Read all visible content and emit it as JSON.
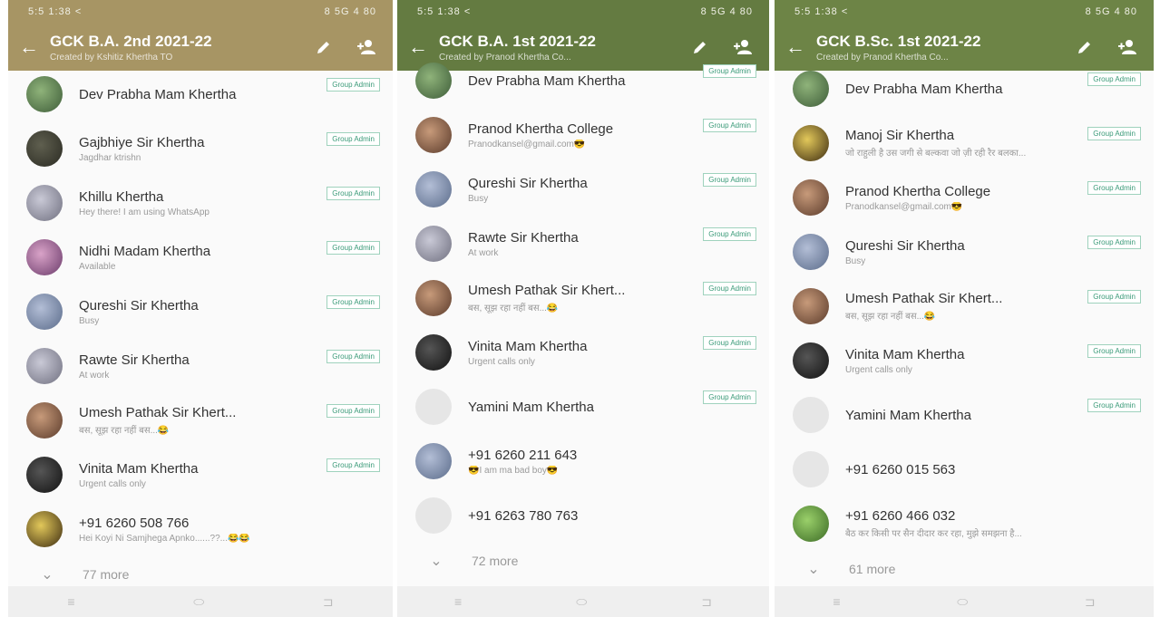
{
  "colors": {
    "panel1_header": "#a79564",
    "panel2_header": "#647b41",
    "panel3_header": "#6d8446",
    "badge_text": "#3a9a78"
  },
  "panels": [
    {
      "status_time": "5:5 1:38 <",
      "status_icons": "8 5G 4 80",
      "title": "GCK B.A. 2nd 2021-22",
      "subtitle": "Created by Kshitiz Khertha TO",
      "members": [
        {
          "name": "Dev Prabha Mam Khertha",
          "status": "",
          "admin": true
        },
        {
          "name": "Gajbhiye Sir Khertha",
          "status": "Jagdhar ktrishn",
          "admin": true
        },
        {
          "name": "Khillu Khertha",
          "status": "Hey there! I am using WhatsApp",
          "admin": true
        },
        {
          "name": "Nidhi Madam Khertha",
          "status": "Available",
          "admin": true
        },
        {
          "name": "Qureshi Sir Khertha",
          "status": "Busy",
          "admin": true
        },
        {
          "name": "Rawte Sir Khertha",
          "status": "At work",
          "admin": true
        },
        {
          "name": "Umesh Pathak Sir Khert...",
          "status": "बस, सूझ रहा नहीं बस...😂",
          "admin": true
        },
        {
          "name": "Vinita Mam Khertha",
          "status": "Urgent calls only",
          "admin": true
        },
        {
          "name": "+91 6260 508 766",
          "status": "Hei Koyi Ni Samjhega Apnko......??...😂😂",
          "admin": false
        }
      ],
      "more": "77 more"
    },
    {
      "status_time": "5:5 1:38 <",
      "status_icons": "8 5G 4 80",
      "title": "GCK B.A. 1st 2021-22",
      "subtitle": "Created by Pranod Khertha Co...",
      "members": [
        {
          "name": "Dev Prabha Mam Khertha",
          "status": "",
          "admin": true
        },
        {
          "name": "Pranod Khertha College",
          "status": "Pranodkansel@gmail.com😎",
          "admin": true
        },
        {
          "name": "Qureshi Sir Khertha",
          "status": "Busy",
          "admin": true
        },
        {
          "name": "Rawte Sir Khertha",
          "status": "At work",
          "admin": true
        },
        {
          "name": "Umesh Pathak Sir Khert...",
          "status": "बस, सूझ रहा नहीं बस...😂",
          "admin": true
        },
        {
          "name": "Vinita Mam Khertha",
          "status": "Urgent calls only",
          "admin": true
        },
        {
          "name": "Yamini Mam Khertha",
          "status": "",
          "admin": true
        },
        {
          "name": "+91 6260 211 643",
          "status": "😎I am ma bad boy😎",
          "admin": false
        },
        {
          "name": "+91 6263 780 763",
          "status": "",
          "admin": false
        }
      ],
      "more": "72 more"
    },
    {
      "status_time": "5:5 1:38 <",
      "status_icons": "8 5G 4 80",
      "title": "GCK B.Sc. 1st 2021-22",
      "subtitle": "Created by Pranod Khertha Co...",
      "members": [
        {
          "name": "Dev Prabha Mam Khertha",
          "status": "",
          "admin": true
        },
        {
          "name": "Manoj Sir Khertha",
          "status": "जो राहुली है उस जगी से बल्कवा जो ज़ी रही रैर बलका...",
          "admin": true
        },
        {
          "name": "Pranod Khertha College",
          "status": "Pranodkansel@gmail.com😎",
          "admin": true
        },
        {
          "name": "Qureshi Sir Khertha",
          "status": "Busy",
          "admin": true
        },
        {
          "name": "Umesh Pathak Sir Khert...",
          "status": "बस, सूझ रहा नहीं बस...😂",
          "admin": true
        },
        {
          "name": "Vinita Mam Khertha",
          "status": "Urgent calls only",
          "admin": true
        },
        {
          "name": "Yamini Mam Khertha",
          "status": "",
          "admin": true
        },
        {
          "name": "+91 6260 015 563",
          "status": "",
          "admin": false
        },
        {
          "name": "+91 6260 466 032",
          "status": "बैठ कर किसी पर सैन दीदार कर रहा, मुझे समझना है...",
          "admin": false
        }
      ],
      "more": "61 more"
    }
  ],
  "badge_label": "Group Admin",
  "nav": {
    "menu": "≡",
    "home": "⬭",
    "back": "⊐"
  }
}
